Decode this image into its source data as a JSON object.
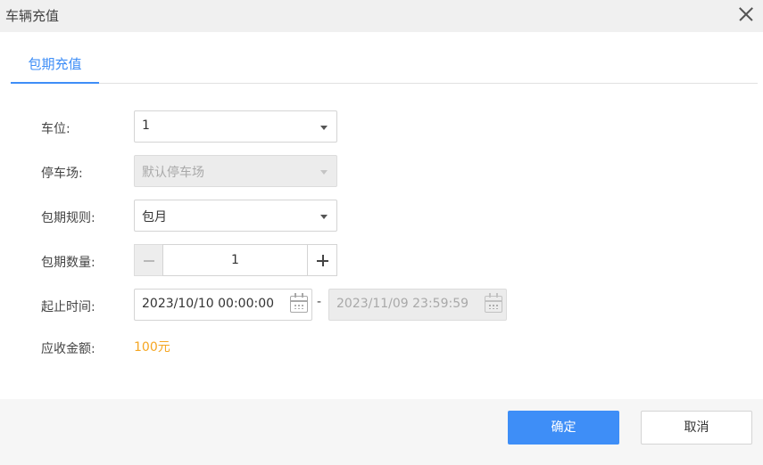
{
  "dialog": {
    "title": "车辆充值"
  },
  "tabs": [
    {
      "label": "包期充值",
      "active": true
    }
  ],
  "form": {
    "space": {
      "label": "车位:",
      "value": "1"
    },
    "parking_lot": {
      "label": "停车场:",
      "value": "默认停车场",
      "disabled": true
    },
    "period_rule": {
      "label": "包期规则:",
      "value": "包月"
    },
    "period_count": {
      "label": "包期数量:",
      "value": "1"
    },
    "time_range": {
      "label": "起止时间:",
      "start": "2023/10/10 00:00:00",
      "separator": "-",
      "end": "2023/11/09 23:59:59",
      "end_disabled": true
    },
    "amount": {
      "label": "应收金额:",
      "value": "100元"
    }
  },
  "footer": {
    "ok_label": "确定",
    "cancel_label": "取消"
  },
  "icons": [
    "close-icon",
    "caret-down-icon",
    "minus-icon",
    "plus-icon",
    "calendar-icon"
  ],
  "colors": {
    "accent": "#3e8ef7",
    "amount": "#f5a623",
    "disabled_bg": "#ececec"
  }
}
